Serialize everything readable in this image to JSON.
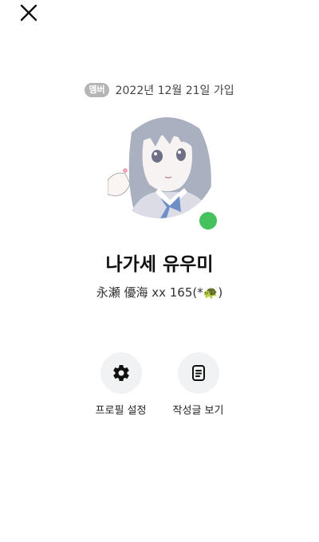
{
  "header": {
    "close_icon": "close-icon"
  },
  "profile": {
    "member_badge": "멤버",
    "join_date": "2022년 12월 21일 가입",
    "avatar": "anime-girl-avatar",
    "online": true,
    "online_color": "#45c25d",
    "name": "나가세 유우미",
    "status_message": "永瀬 優海 xx 165(*🐢)"
  },
  "actions": [
    {
      "label": "프로필 설정",
      "icon": "gear-icon"
    },
    {
      "label": "작성글 보기",
      "icon": "document-icon"
    }
  ]
}
